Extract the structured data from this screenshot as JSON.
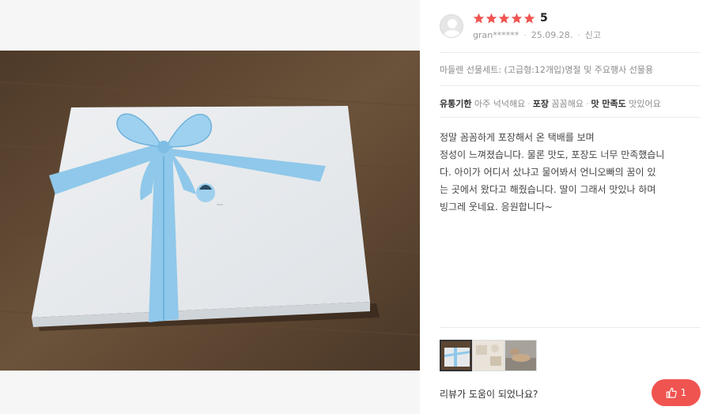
{
  "review": {
    "rating_value": "5",
    "rating_stars": 5,
    "reviewer_name": "gran******",
    "date": "25.09.28.",
    "report_label": "신고",
    "option": "마들렌 선물세트: (고급형:12개입)명절 및 주요행사 선물용",
    "tags": [
      {
        "name": "유통기한",
        "value": "아주 넉넉해요"
      },
      {
        "name": "포장",
        "value": "꼼꼼해요"
      },
      {
        "name": "맛 만족도",
        "value": "맛있어요"
      }
    ],
    "text_lines": [
      "정말 꼼꼼하게 포장해서 온 택배를 보며",
      "정성이 느껴졌습니다. 물론 맛도, 포장도 너무 만족했습니",
      "다. 아이가 어디서 샀냐고 물어봐서 언니오빠의  꿈이 있",
      "는 곳에서 왔다고 해줬습니다. 딸이 그래서 맛있나 하며",
      "빙그레 웃네요. 응원합니다~"
    ]
  },
  "footer": {
    "helpful_question": "리뷰가 도움이 되었나요?",
    "like_count": "1"
  },
  "colors": {
    "star": "#f05450",
    "like_button": "#f05450",
    "ribbon": "#8fc8ea"
  },
  "icons": {
    "star": "star-icon",
    "thumbs_up": "thumbs-up-icon",
    "avatar": "default-avatar-icon"
  }
}
